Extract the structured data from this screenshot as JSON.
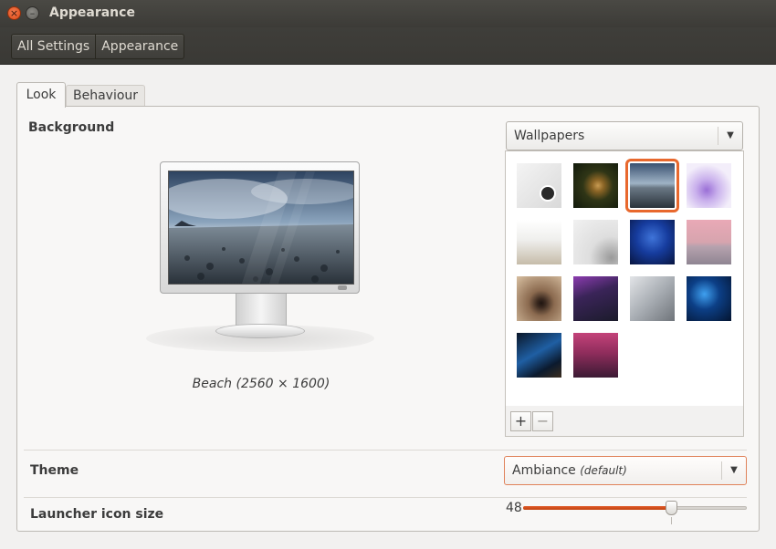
{
  "window": {
    "title": "Appearance"
  },
  "breadcrumbs": [
    "All Settings",
    "Appearance"
  ],
  "tabs": {
    "look": "Look",
    "behaviour": "Behaviour"
  },
  "background": {
    "label": "Background",
    "source_selected": "Wallpapers",
    "caption": "Beach (2560 × 1600)",
    "add_label": "+",
    "remove_label": "−",
    "selected_index": 2,
    "thumbnails": [
      {
        "name": "default-dot"
      },
      {
        "name": "mushroom"
      },
      {
        "name": "beach"
      },
      {
        "name": "purple-flowers"
      },
      {
        "name": "foggy-horizon"
      },
      {
        "name": "white-curve"
      },
      {
        "name": "jellyfish"
      },
      {
        "name": "pink-reflection"
      },
      {
        "name": "spiral-tunnel"
      },
      {
        "name": "purple-road"
      },
      {
        "name": "grey-plane"
      },
      {
        "name": "blue-bokeh"
      },
      {
        "name": "galaxy"
      },
      {
        "name": "red-purple-gradient"
      }
    ]
  },
  "theme": {
    "label": "Theme",
    "value": "Ambiance",
    "suffix": "(default)"
  },
  "launcher": {
    "label": "Launcher icon size",
    "value": "48",
    "fraction": 0.66
  },
  "colors": {
    "accent": "#e8682d",
    "titlebar": "#3c3b37"
  }
}
